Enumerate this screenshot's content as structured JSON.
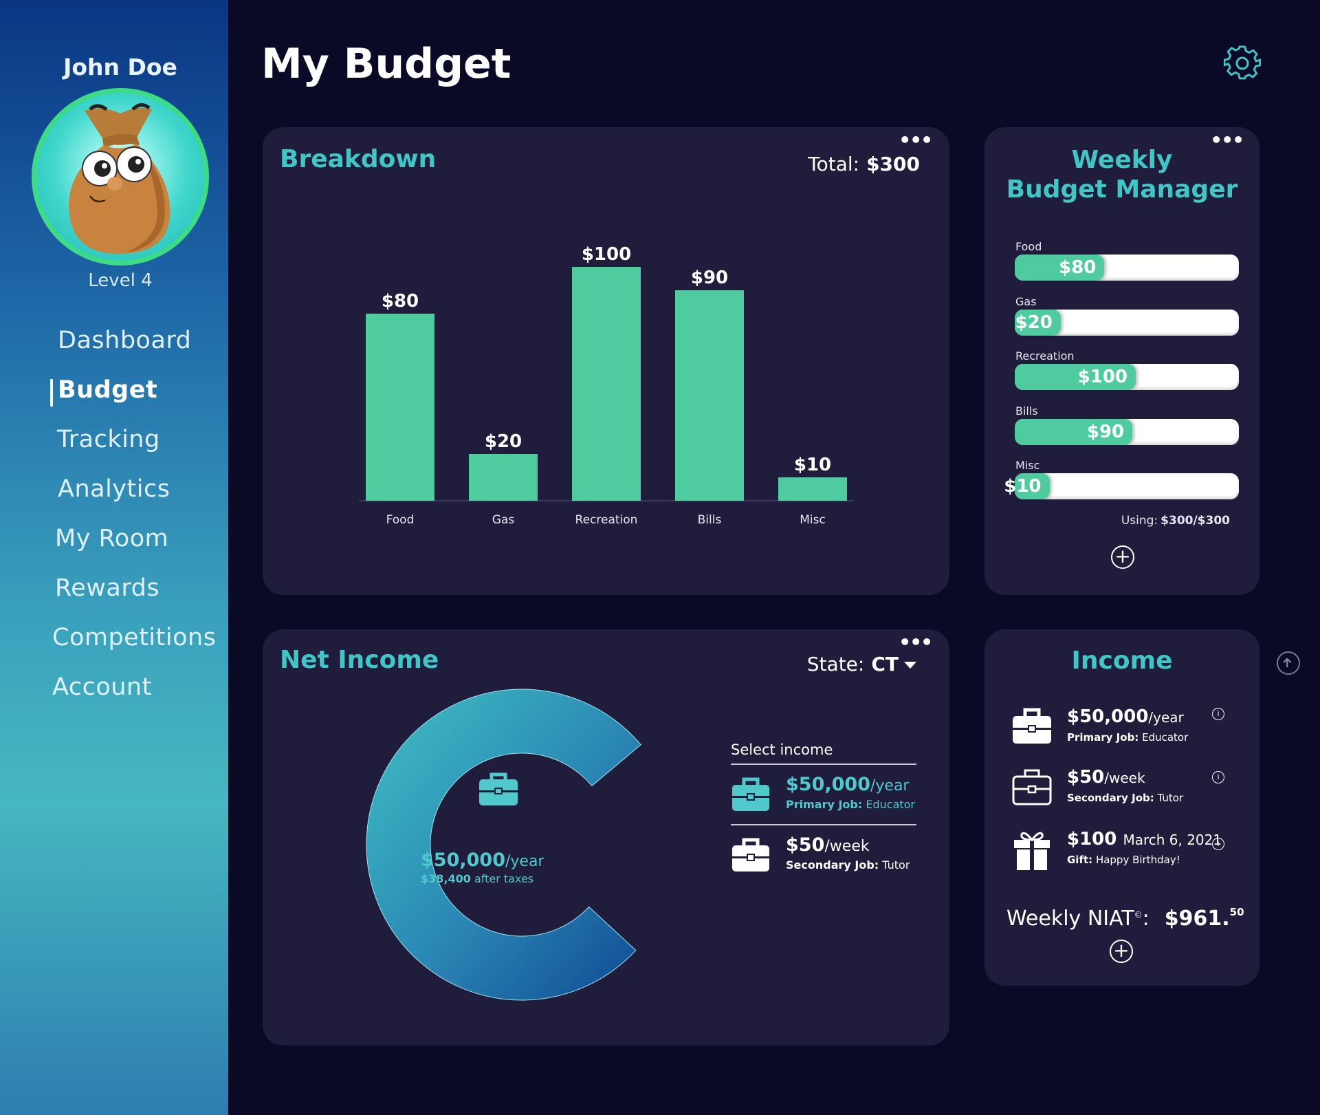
{
  "user": {
    "name": "John Doe",
    "level": "Level 4"
  },
  "nav": [
    {
      "label": "Dashboard",
      "active": false
    },
    {
      "label": "Budget",
      "active": true
    },
    {
      "label": "Tracking",
      "active": false
    },
    {
      "label": "Analytics",
      "active": false
    },
    {
      "label": "My Room",
      "active": false
    },
    {
      "label": "Rewards",
      "active": false
    },
    {
      "label": "Competitions",
      "active": false
    },
    {
      "label": "Account",
      "active": false
    }
  ],
  "header": {
    "title": "My Budget",
    "settings_icon": "gear-icon"
  },
  "breakdown": {
    "title": "Breakdown",
    "total_label": "Total:",
    "total_value": "$300",
    "more_icon": "ellipsis-icon"
  },
  "chart_data": {
    "type": "bar",
    "categories": [
      "Food",
      "Gas",
      "Recreation",
      "Bills",
      "Misc"
    ],
    "values": [
      80,
      20,
      100,
      90,
      10
    ],
    "value_labels": [
      "$80",
      "$20",
      "$100",
      "$90",
      "$10"
    ],
    "ylim": [
      0,
      100
    ],
    "color": "#4ecb9f",
    "grid": false
  },
  "weekly_budget": {
    "title_line1": "Weekly",
    "title_line2": "Budget Manager",
    "items": [
      {
        "label": "Food",
        "value": "$80",
        "fraction": 0.4
      },
      {
        "label": "Gas",
        "value": "$20",
        "fraction": 0.205
      },
      {
        "label": "Recreation",
        "value": "$100",
        "fraction": 0.54
      },
      {
        "label": "Bills",
        "value": "$90",
        "fraction": 0.525
      },
      {
        "label": "Misc",
        "value": "$10",
        "fraction": 0.155
      }
    ],
    "using_label": "Using:",
    "using_value": "$300/$300",
    "add_icon": "plus-circle-icon"
  },
  "net_income": {
    "title": "Net Income",
    "state_label": "State:",
    "state_value": "CT",
    "center_amount": "$50,000",
    "center_unit": "/year",
    "center_after": "$38,400",
    "center_after_label": "after taxes",
    "donut_fraction": 0.77,
    "select_title": "Select income",
    "options": [
      {
        "amount": "$50,000",
        "unit": "/year",
        "role": "Primary Job:",
        "detail": "Educator",
        "selected": true
      },
      {
        "amount": "$50",
        "unit": "/week",
        "role": "Secondary Job:",
        "detail": "Tutor",
        "selected": false
      }
    ]
  },
  "income": {
    "title": "Income",
    "items": [
      {
        "amount": "$50,000",
        "unit": "/year",
        "role": "Primary Job:",
        "detail": "Educator",
        "icon": "briefcase-icon"
      },
      {
        "amount": "$50",
        "unit": "/week",
        "role": "Secondary Job:",
        "detail": "Tutor",
        "icon": "briefcase-outline-icon"
      },
      {
        "amount": "$100",
        "unit": "March 6, 2021",
        "role": "Gift:",
        "detail": "Happy Birthday!",
        "icon": "gift-icon"
      }
    ],
    "niat_label": "Weekly NIAT",
    "niat_mark": "©",
    "niat_colon": ":",
    "niat_value": "$961.",
    "niat_cents": "50"
  },
  "colors": {
    "accent": "#3fc7c7",
    "bar": "#4ecb9f",
    "card": "#1f1d3b",
    "background": "#0b0a26"
  }
}
